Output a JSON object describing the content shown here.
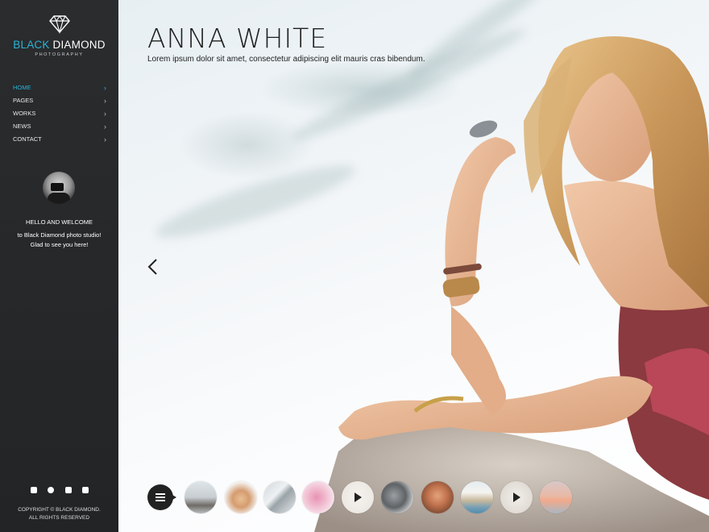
{
  "brand": {
    "accent": "BLACK",
    "rest": " DIAMOND",
    "tagline": "PHOTOGRAPHY"
  },
  "nav": [
    {
      "label": "HOME",
      "active": true
    },
    {
      "label": "PAGES",
      "active": false
    },
    {
      "label": "WORKS",
      "active": false
    },
    {
      "label": "NEWS",
      "active": false
    },
    {
      "label": "CONTACT",
      "active": false
    }
  ],
  "welcome": {
    "title": "HELLO AND WELCOME",
    "line1": "to Black Diamond photo studio!",
    "line2": "Glad to see you here!"
  },
  "social": [
    "facebook-icon",
    "pinterest-icon",
    "instagram-icon",
    "flickr-icon"
  ],
  "copyright": {
    "line1": "COPYRIGHT ©  BLACK DIAMOND.",
    "line2": "ALL RIGHTS RESERVED"
  },
  "hero": {
    "title": "ANNA WHITE",
    "subtitle": "Lorem ipsum dolor sit amet, consectetur adipiscing elit mauris cras bibendum."
  },
  "thumbnails": [
    {
      "name": "thumb-rocks-sea",
      "video": false
    },
    {
      "name": "thumb-woman-blonde",
      "video": false
    },
    {
      "name": "thumb-architecture",
      "video": false
    },
    {
      "name": "thumb-pink-flowers",
      "video": false
    },
    {
      "name": "thumb-video",
      "video": true
    },
    {
      "name": "thumb-stones",
      "video": false
    },
    {
      "name": "thumb-woman-hat",
      "video": false
    },
    {
      "name": "thumb-town",
      "video": false
    },
    {
      "name": "thumb-video-2",
      "video": true
    },
    {
      "name": "thumb-sunset",
      "video": false
    }
  ],
  "colors": {
    "accent": "#2bb3d6",
    "sidebar": "#252729",
    "text": "#1e1e1e"
  }
}
